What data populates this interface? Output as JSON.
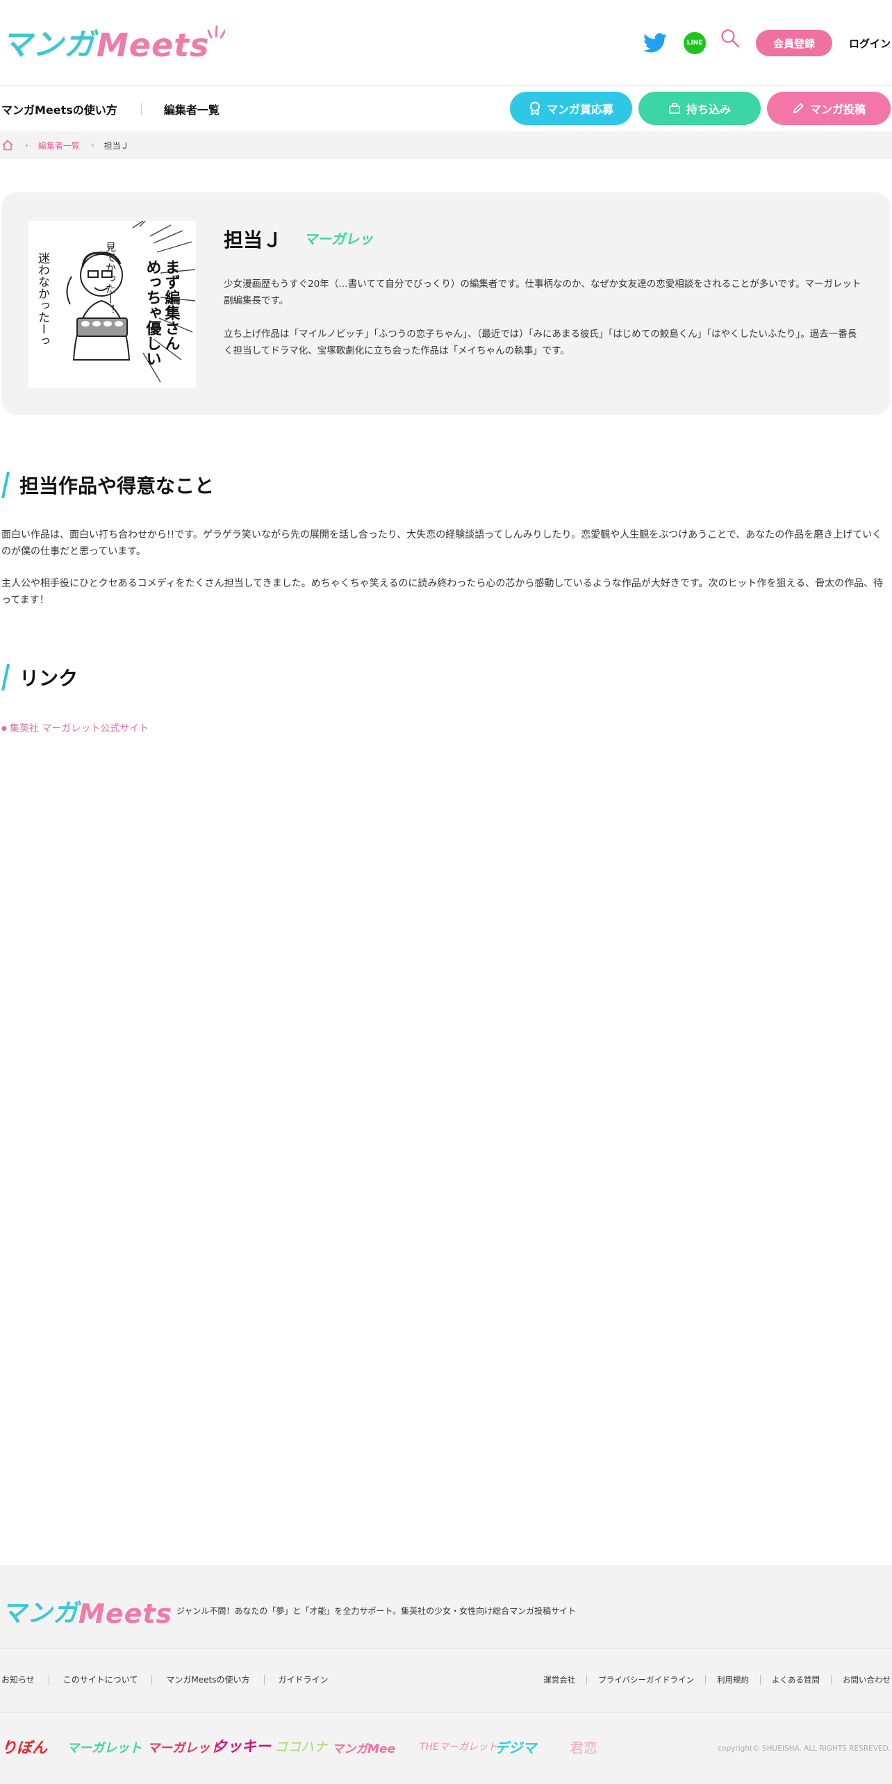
{
  "header": {
    "logo": {
      "part1": "マンガ",
      "part2": "Meets"
    },
    "register_label": "会員登録",
    "login_label": "ログイン"
  },
  "nav": {
    "links": [
      "マンガMeetsの使い方",
      "編集者一覧"
    ],
    "buttons": [
      "マンガ賞応募",
      "持ち込み",
      "マンガ投稿"
    ],
    "colors": {
      "award": "#2ec8e6",
      "bring": "#3bd6a3",
      "post": "#f277a6"
    }
  },
  "breadcrumb": {
    "link": "編集者一覧",
    "current": "担当Ｊ"
  },
  "editor": {
    "name": "担当Ｊ",
    "magazine_label": "マーガレット",
    "portrait_text": [
      "まず編集さん",
      "めっちゃ優しい",
      "見てかったー！",
      "迷わなかったーっ"
    ],
    "bio": [
      "少女漫画歴もうすぐ20年（…書いてて自分でびっくり）の編集者です。仕事柄なのか、なぜか女友達の恋愛相談をされることが多いです。マーガレット副編集長です。",
      "立ち上げ作品は「マイルノビッチ」「ふつうの恋子ちゃん」、（最近では）「みにあまる彼氏」「はじめての鮫島くん」「はやくしたいふたり」。過去一番長く担当してドラマ化、宝塚歌劇化に立ち会った作品は「メイちゃんの執事」です。"
    ]
  },
  "section_works": {
    "title": "担当作品や得意なこと",
    "paragraphs": [
      "面白い作品は、面白い打ち合わせから!!です。ゲラゲラ笑いながら先の展開を話し合ったり、大失恋の経験談語ってしんみりしたり。恋愛観や人生観をぶつけあうことで、あなたの作品を磨き上げていくのが僕の仕事だと思っています。",
      "主人公や相手役にひとクセあるコメディをたくさん担当してきました。めちゃくちゃ笑えるのに読み終わったら心の芯から感動しているような作品が大好きです。次のヒット作を狙える、骨太の作品、待ってます！"
    ]
  },
  "section_links": {
    "title": "リンク",
    "items": [
      "集英社 マーガレット公式サイト"
    ]
  },
  "footer": {
    "logo": {
      "part1": "マンガ",
      "part2": "Meets"
    },
    "tagline": "ジャンル不問！あなたの「夢」と「才能」を全力サポート。集英社の少女・女性向け総合マンガ投稿サイト",
    "links_left": [
      "お知らせ",
      "このサイトについて",
      "マンガMeetsの使い方",
      "ガイドライン"
    ],
    "links_right": [
      "運営会社",
      "プライバシーガイドライン",
      "利用規約",
      "よくある質問",
      "お問い合わせ"
    ],
    "magazines": [
      "りぼん",
      "マーガレット",
      "マーガレット",
      "クッキー",
      "ココハナ",
      "マンガMee",
      "THEマーガレット",
      "デジマ",
      "君恋"
    ],
    "copyright": "copyright© SHUEISHA. ALL RIGHTS RESREVED."
  }
}
